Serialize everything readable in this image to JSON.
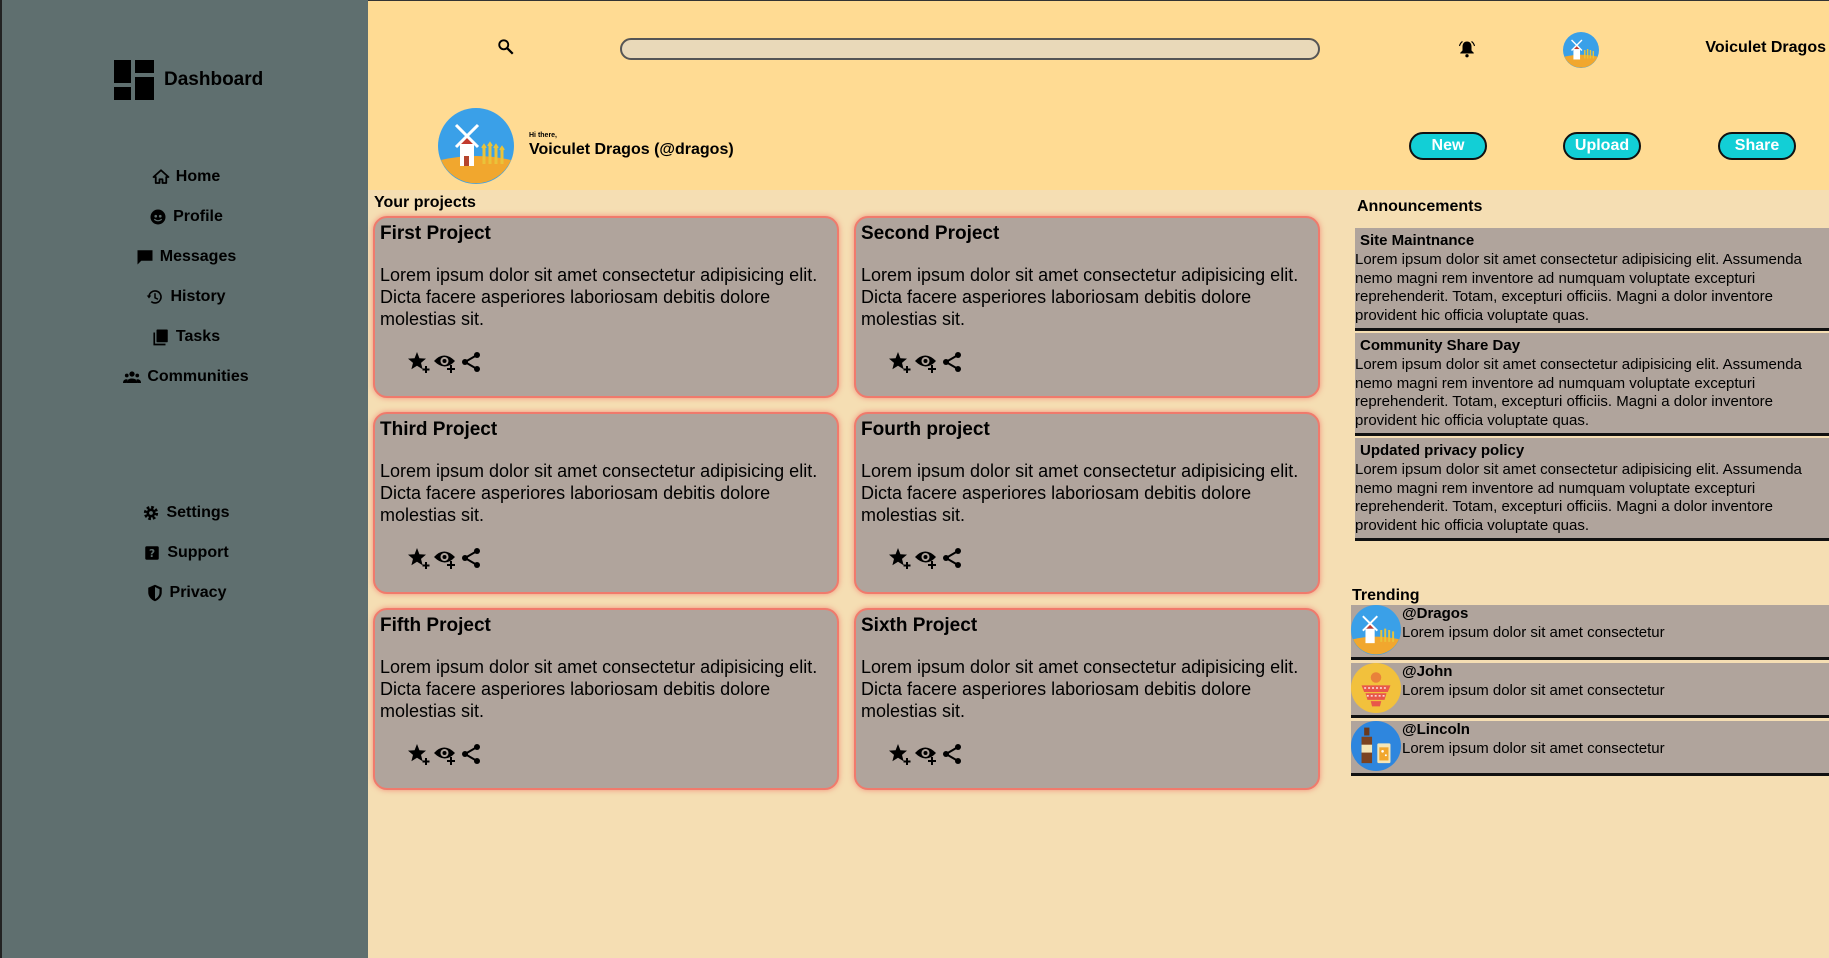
{
  "sidebar": {
    "brand": "Dashboard",
    "nav": [
      {
        "label": "Home",
        "icon": "home-icon"
      },
      {
        "label": "Profile",
        "icon": "profile-icon"
      },
      {
        "label": "Messages",
        "icon": "message-icon"
      },
      {
        "label": "History",
        "icon": "history-icon"
      },
      {
        "label": "Tasks",
        "icon": "tasks-icon"
      },
      {
        "label": "Communities",
        "icon": "communities-icon"
      }
    ],
    "secondary": [
      {
        "label": "Settings",
        "icon": "gear-icon"
      },
      {
        "label": "Support",
        "icon": "help-icon"
      },
      {
        "label": "Privacy",
        "icon": "shield-icon"
      }
    ]
  },
  "header": {
    "search": {
      "value": "",
      "placeholder": ""
    },
    "user_name": "Voiculet Dragos",
    "greeting": "Hi there,",
    "full_name": "Voiculet Dragos (@dragos)",
    "buttons": {
      "new": "New",
      "upload": "Upload",
      "share": "Share"
    }
  },
  "projects": {
    "title": "Your projects",
    "items": [
      {
        "title": "First Project",
        "text": "Lorem ipsum dolor sit amet consectetur adipisicing elit. Dicta facere asperiores laboriosam debitis dolore molestias sit."
      },
      {
        "title": "Second Project",
        "text": "Lorem ipsum dolor sit amet consectetur adipisicing elit. Dicta facere asperiores laboriosam debitis dolore molestias sit."
      },
      {
        "title": "Third Project",
        "text": "Lorem ipsum dolor sit amet consectetur adipisicing elit. Dicta facere asperiores laboriosam debitis dolore molestias sit."
      },
      {
        "title": "Fourth project",
        "text": "Lorem ipsum dolor sit amet consectetur adipisicing elit. Dicta facere asperiores laboriosam debitis dolore molestias sit."
      },
      {
        "title": "Fifth Project",
        "text": "Lorem ipsum dolor sit amet consectetur adipisicing elit. Dicta facere asperiores laboriosam debitis dolore molestias sit."
      },
      {
        "title": "Sixth Project",
        "text": "Lorem ipsum dolor sit amet consectetur adipisicing elit. Dicta facere asperiores laboriosam debitis dolore molestias sit."
      }
    ]
  },
  "announcements": {
    "title": "Announcements",
    "items": [
      {
        "title": "Site Maintnance",
        "text": "Lorem ipsum dolor sit amet consectetur adipisicing elit. Assumenda nemo magni rem inventore ad numquam voluptate excepturi reprehenderit. Totam, excepturi officiis. Magni a dolor inventore provident hic officia voluptate quas."
      },
      {
        "title": "Community Share Day",
        "text": "Lorem ipsum dolor sit amet consectetur adipisicing elit. Assumenda nemo magni rem inventore ad numquam voluptate excepturi reprehenderit. Totam, excepturi officiis. Magni a dolor inventore provident hic officia voluptate quas."
      },
      {
        "title": "Updated privacy policy",
        "text": "Lorem ipsum dolor sit amet consectetur adipisicing elit. Assumenda nemo magni rem inventore ad numquam voluptate excepturi reprehenderit. Totam, excepturi officiis. Magni a dolor inventore provident hic officia voluptate quas."
      }
    ]
  },
  "trending": {
    "title": "Trending",
    "items": [
      {
        "handle": "@Dragos",
        "text": "Lorem ipsum dolor sit amet consectetur",
        "avatar": "windmill-avatar"
      },
      {
        "handle": "@John",
        "text": "Lorem ipsum dolor sit amet consectetur",
        "avatar": "cupcakes-avatar"
      },
      {
        "handle": "@Lincoln",
        "text": "Lorem ipsum dolor sit amet consectetur",
        "avatar": "bottle-avatar"
      }
    ]
  },
  "colors": {
    "sidebar": "#5f6f6f",
    "topbar": "#ffdb93",
    "page": "#f5deb3",
    "card": "#b0a49c",
    "card_border": "#f07a6c",
    "button": "#12cfd6"
  }
}
